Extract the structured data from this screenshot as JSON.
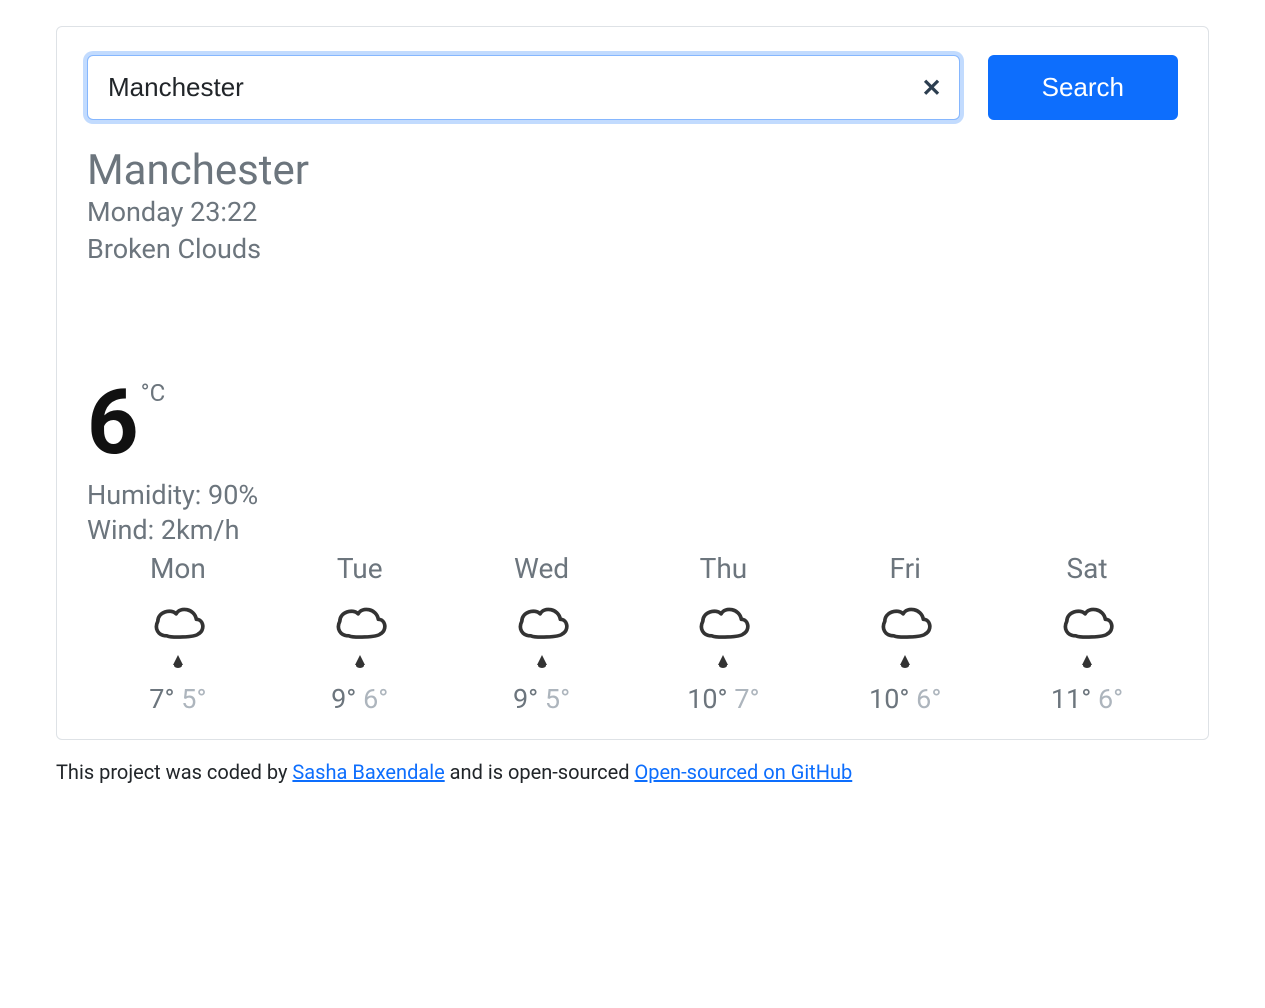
{
  "search": {
    "value": "Manchester",
    "button_label": "Search"
  },
  "current": {
    "city": "Manchester",
    "day_time": "Monday 23:22",
    "description": "Broken Clouds",
    "temp": "6",
    "unit": "°C",
    "humidity_label": "Humidity: 90%",
    "wind_label": "Wind: 2km/h"
  },
  "forecast": [
    {
      "day": "Mon",
      "icon": "cloud-drizzle",
      "hi": "7°",
      "lo": "5°"
    },
    {
      "day": "Tue",
      "icon": "cloud-drizzle",
      "hi": "9°",
      "lo": "6°"
    },
    {
      "day": "Wed",
      "icon": "cloud-drizzle",
      "hi": "9°",
      "lo": "5°"
    },
    {
      "day": "Thu",
      "icon": "cloud-drizzle",
      "hi": "10°",
      "lo": "7°"
    },
    {
      "day": "Fri",
      "icon": "cloud-drizzle",
      "hi": "10°",
      "lo": "6°"
    },
    {
      "day": "Sat",
      "icon": "cloud-drizzle",
      "hi": "11°",
      "lo": "6°"
    }
  ],
  "footer": {
    "prefix": "This project was coded by ",
    "author": "Sasha Baxendale",
    "middle": " and is open-sourced ",
    "link": "Open-sourced on GitHub"
  }
}
